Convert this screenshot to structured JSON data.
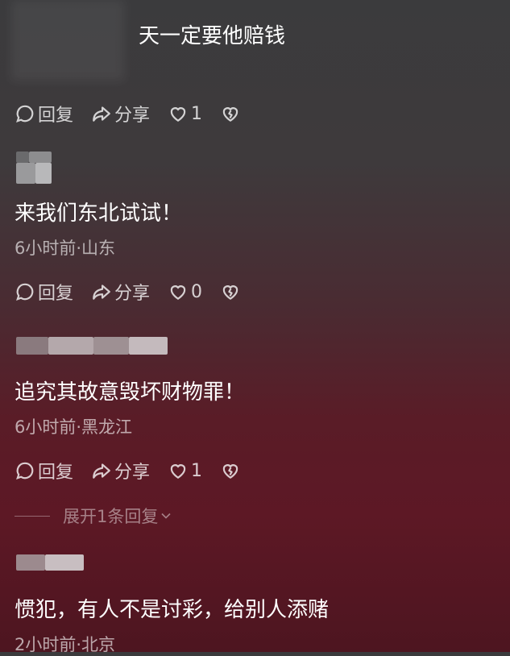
{
  "comments": [
    {
      "text": "天一定要他赔钱",
      "actions": {
        "reply": "回复",
        "share": "分享",
        "likes": "1"
      }
    },
    {
      "text": "来我们东北试试！",
      "meta": "6小时前·山东",
      "actions": {
        "reply": "回复",
        "share": "分享",
        "likes": "0"
      }
    },
    {
      "text": "追究其故意毁坏财物罪！",
      "meta": "6小时前·黑龙江",
      "actions": {
        "reply": "回复",
        "share": "分享",
        "likes": "1"
      },
      "expand_replies": "展开1条回复"
    },
    {
      "text": "惯犯，有人不是讨彩，给别人添赌",
      "meta": "2小时前·北京"
    }
  ],
  "icons": {
    "reply": "comment-bubble-icon",
    "share": "share-arrow-icon",
    "like": "heart-icon",
    "dislike": "broken-heart-icon",
    "expand": "chevron-down-icon"
  },
  "colors": {
    "text": "#ffffff",
    "meta": "#a8a0a2",
    "background_top": "#3b3b3d",
    "background_bottom": "#5d1825"
  }
}
